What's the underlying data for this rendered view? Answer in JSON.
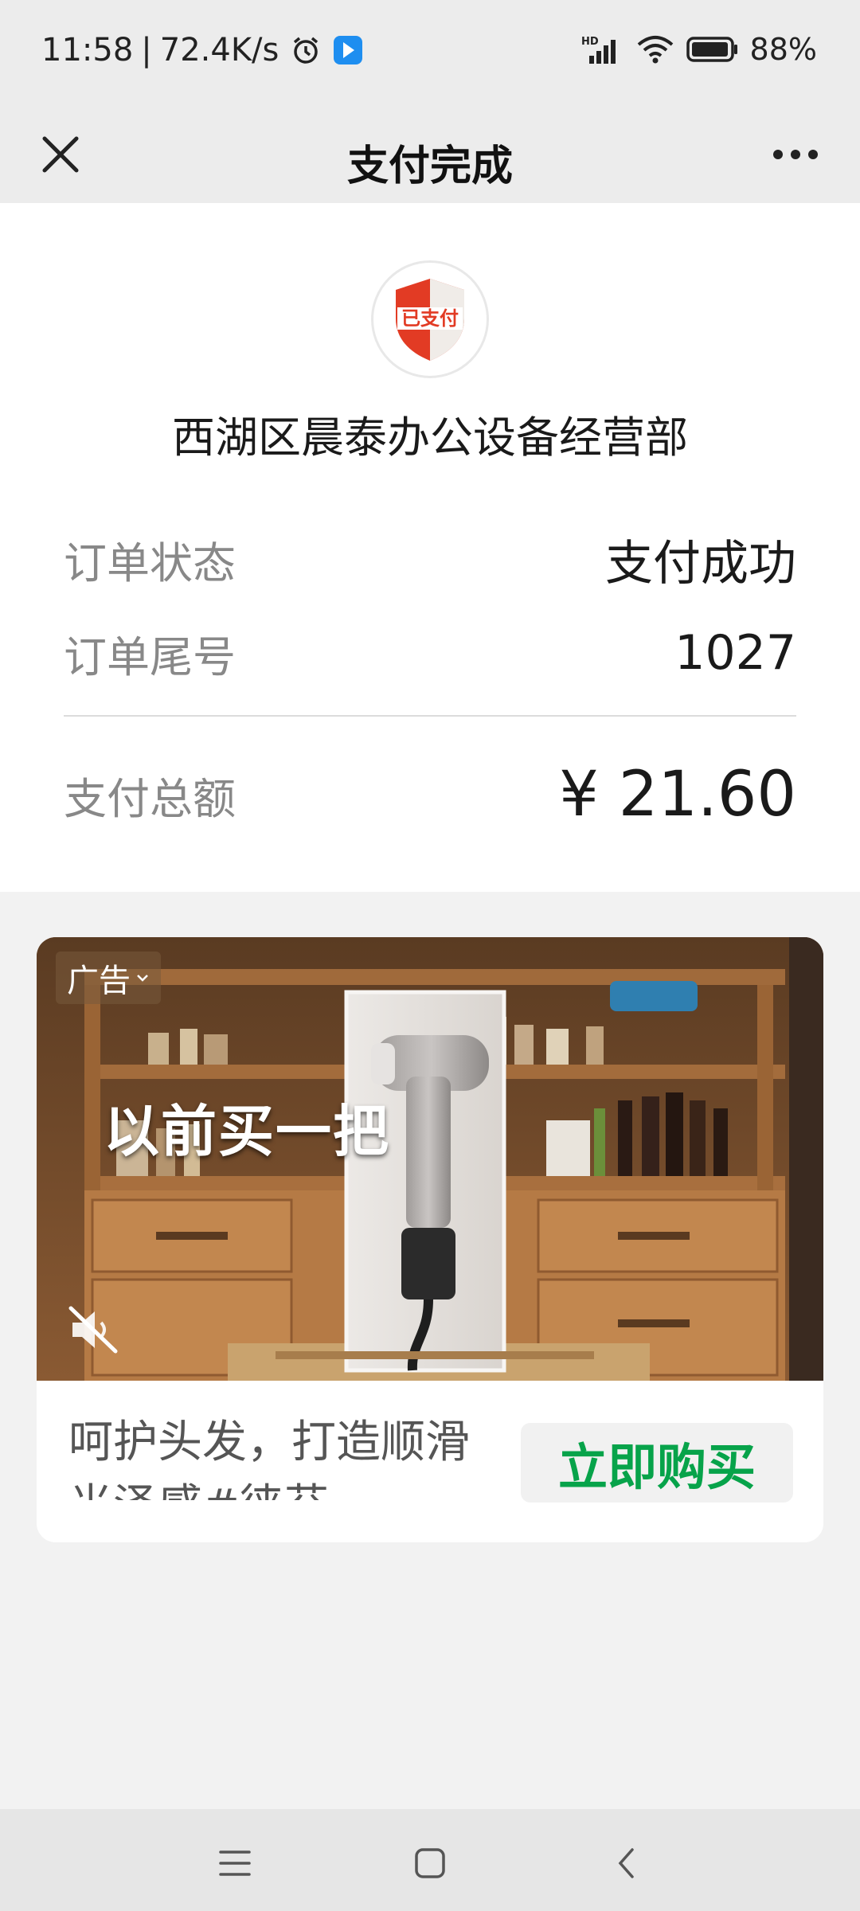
{
  "status_bar": {
    "time": "11:58",
    "separator": "|",
    "network_speed": "72.4K/s",
    "signal_label": "HD",
    "battery": "88%"
  },
  "nav": {
    "title": "支付完成",
    "close_icon": "close-icon",
    "more_icon": "more-icon"
  },
  "badge": {
    "text": "已支付",
    "icon": "paid-shield-icon"
  },
  "merchant": "西湖区晨泰办公设备经营部",
  "order": {
    "status_label": "订单状态",
    "status_value": "支付成功",
    "tail_label": "订单尾号",
    "tail_value": "1027",
    "total_label": "支付总额",
    "total_value": "¥ 21.60"
  },
  "ad": {
    "tag": "广告",
    "headline": "以前买一把",
    "description": "呵护头发，打造顺滑光泽感#徕芬",
    "buy_label": "立即购买",
    "accent": "#07a34a"
  },
  "colors": {
    "background": "#f2f2f2",
    "bar": "#ececec",
    "badge_red": "#e23b24"
  }
}
